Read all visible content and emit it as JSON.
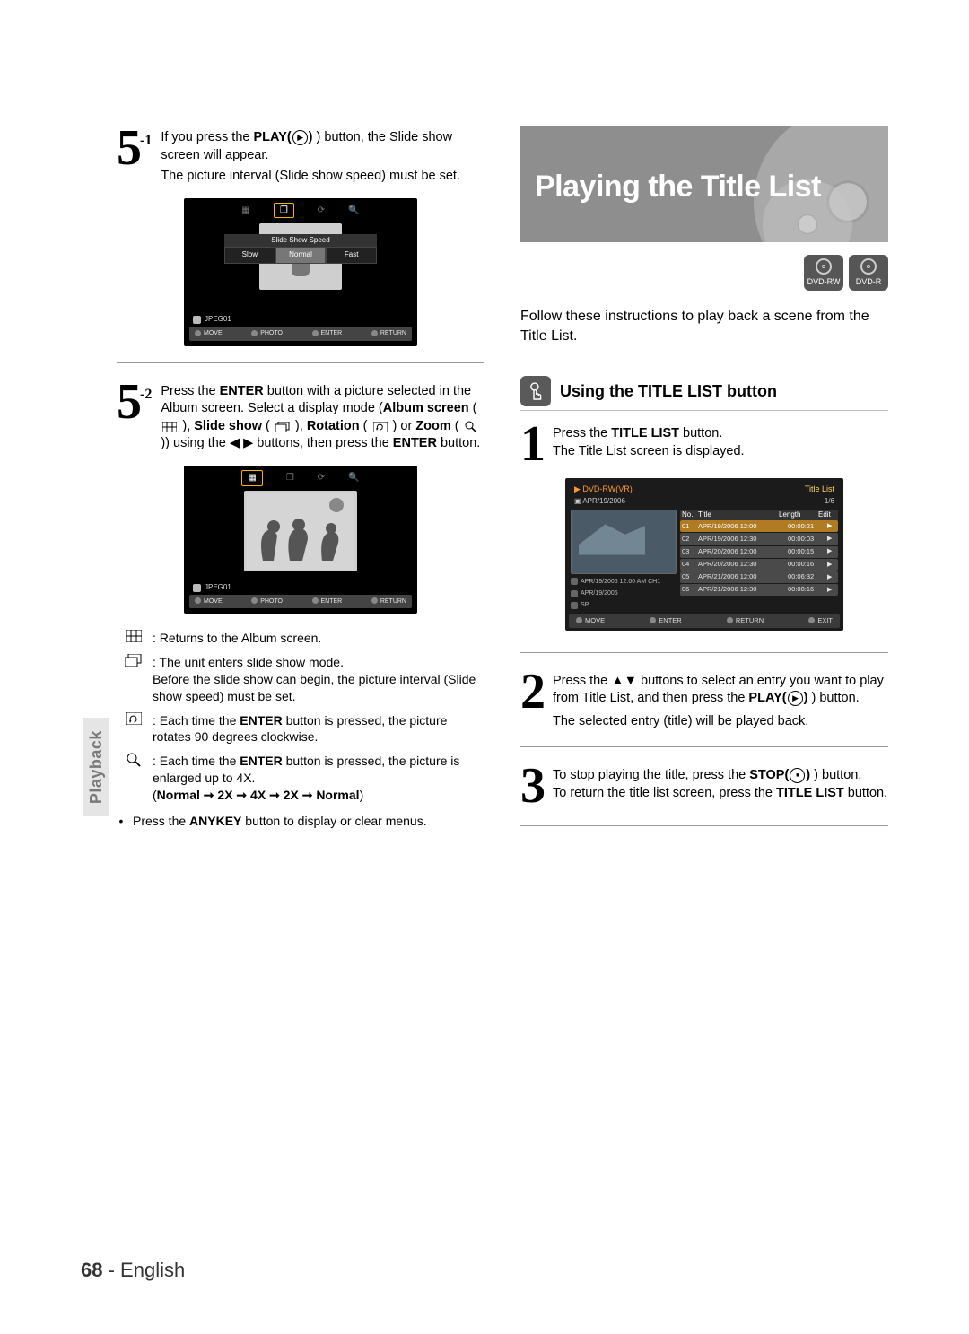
{
  "page_number": "68",
  "page_lang": "English",
  "side_tab": "Playback",
  "left": {
    "step51": {
      "num": "5",
      "sup": "-1",
      "line1_pre": "If you press the ",
      "line1_bold": "PLAY(",
      "line1_post": ") button, the Slide show screen will appear.",
      "line2": "The picture interval (Slide show speed) must be set."
    },
    "osd1": {
      "speed_title": "Slide Show Speed",
      "slow": "Slow",
      "normal": "Normal",
      "fast": "Fast",
      "file": "JPEG01",
      "move": "MOVE",
      "photo": "PHOTO",
      "enter": "ENTER",
      "return": "RETURN"
    },
    "step52": {
      "num": "5",
      "sup": "-2",
      "t1_pre": "Press the ",
      "t1_b1": "ENTER",
      "t1_mid1": " button with a picture selected in the Album screen. Select a display mode (",
      "t1_b2": "Album screen",
      "t1_mid2": " ( ",
      "t1_mid2b": " ), ",
      "t1_b3": "Slide show",
      "t1_mid3": " ( ",
      "t1_mid3b": " ), ",
      "t1_b4": "Rotation",
      "t1_mid4": " ( ",
      "t1_mid4b": " ) or ",
      "t1_b5": "Zoom",
      "t1_mid5": " ( ",
      "t1_mid5b": " )) using the ◀ ▶ buttons, then press the ",
      "t1_b6": "ENTER",
      "t1_end": " button."
    },
    "osd2": {
      "file": "JPEG01",
      "move": "MOVE",
      "photo": "PHOTO",
      "enter": "ENTER",
      "return": "RETURN"
    },
    "legend": {
      "album": "Returns to the Album screen.",
      "slide1": "The unit enters slide show mode.",
      "slide2": "Before the slide show can begin, the picture interval (Slide show speed) must be set.",
      "rot_pre": "Each time the ",
      "rot_b": "ENTER",
      "rot_post": " button is pressed, the picture rotates 90 degrees clockwise.",
      "zoom_pre": "Each time the ",
      "zoom_b": "ENTER",
      "zoom_post": " button is pressed, the picture is enlarged up to 4X.",
      "zoom_seq_open": "(",
      "zoom_seq": "Normal ➞ 2X ➞ 4X ➞ 2X ➞ Normal",
      "zoom_seq_close": ")"
    },
    "anykey_pre": "Press the ",
    "anykey_b": "ANYKEY",
    "anykey_post": " button to display or clear menus."
  },
  "right": {
    "hero_title": "Playing the Title List",
    "badge1": "DVD-RW",
    "badge2": "DVD-R",
    "intro": "Follow these instructions to play back a scene from the Title List.",
    "section_title": "Using the TITLE LIST button",
    "step1": {
      "num": "1",
      "l1_pre": "Press the ",
      "l1_b": "TITLE LIST",
      "l1_post": " button.",
      "l2": "The Title List screen is displayed."
    },
    "tl": {
      "disc": "DVD-RW(VR)",
      "title": "Title List",
      "date": "APR/19/2006",
      "counter": "1/6",
      "hdr_no": "No.",
      "hdr_title": "Title",
      "hdr_length": "Length",
      "hdr_edit": "Edit",
      "rows": [
        {
          "no": "01",
          "title": "APR/19/2006 12:00",
          "len": "00:00:21"
        },
        {
          "no": "02",
          "title": "APR/19/2006 12:30",
          "len": "00:00:03"
        },
        {
          "no": "03",
          "title": "APR/20/2006 12:00",
          "len": "00:00:15"
        },
        {
          "no": "04",
          "title": "APR/20/2006 12:30",
          "len": "00:00:16"
        },
        {
          "no": "05",
          "title": "APR/21/2006 12:00",
          "len": "00:06:32"
        },
        {
          "no": "06",
          "title": "APR/21/2006 12:30",
          "len": "00:08:16"
        }
      ],
      "meta1": "APR/19/2006 12:00 AM CH1",
      "meta2": "APR/19/2006",
      "meta3": "SP",
      "move": "MOVE",
      "enter": "ENTER",
      "return": "RETURN",
      "exit": "EXIT"
    },
    "step2": {
      "num": "2",
      "l_pre": "Press the ▲▼ buttons to select an entry you want to play from Title List, and then press the ",
      "l_b": "PLAY(",
      "l_post": ") button.",
      "l2": "The selected entry (title) will be played back."
    },
    "step3": {
      "num": "3",
      "l1_pre": "To stop playing the title, press the ",
      "l1_b": "STOP(",
      "l1_post": ") button.",
      "l2_pre": "To return the title list screen, press the ",
      "l2_b": "TITLE LIST",
      "l2_post": " button."
    }
  }
}
